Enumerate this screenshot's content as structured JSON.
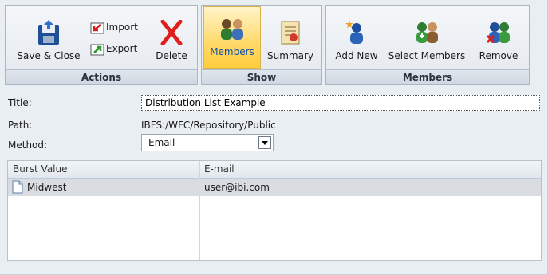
{
  "ribbon": {
    "actions": {
      "caption": "Actions",
      "save_close": "Save & Close",
      "import": "Import",
      "export": "Export",
      "delete": "Delete"
    },
    "show": {
      "caption": "Show",
      "members": "Members",
      "summary": "Summary"
    },
    "members_group": {
      "caption": "Members",
      "add_new": "Add New",
      "select_members": "Select Members",
      "remove": "Remove"
    }
  },
  "form": {
    "title_label": "Title:",
    "title_value": "Distribution List Example",
    "path_label": "Path:",
    "path_value": "IBFS:/WFC/Repository/Public",
    "method_label": "Method:",
    "method_value": "Email"
  },
  "grid": {
    "columns": [
      "Burst Value",
      "E-mail",
      ""
    ],
    "rows": [
      {
        "burst_value": "Midwest",
        "email": "user@ibi.com"
      }
    ]
  },
  "colors": {
    "active_tab": "#ffd96a",
    "selected_row": "#d9dde2",
    "background": "#e9eef3"
  }
}
